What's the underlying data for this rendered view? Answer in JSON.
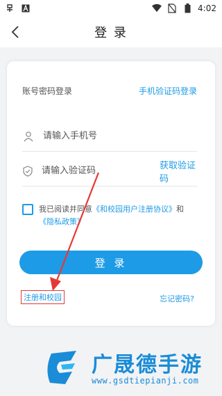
{
  "status_bar": {
    "time": "4:02"
  },
  "header": {
    "title": "登 录"
  },
  "login_mode": {
    "current": "账号密码登录",
    "switch": "手机验证码登录"
  },
  "fields": {
    "phone_placeholder": "请输入手机号",
    "code_placeholder": "请输入验证码",
    "get_code": "获取验证码"
  },
  "agreement": {
    "prefix": "我已阅读并同意",
    "user_agreement": "《和校园用户注册协议》",
    "and": "和",
    "privacy_policy": "《隐私政策》"
  },
  "login_button": "登 录",
  "register_link": "注册和校园",
  "forgot_link": "忘记密码?",
  "watermark": {
    "text": "广晟德手游",
    "url": "www.gsdtiepianji.com"
  },
  "colors": {
    "accent": "#1e9be6",
    "annotation": "#e53935"
  }
}
